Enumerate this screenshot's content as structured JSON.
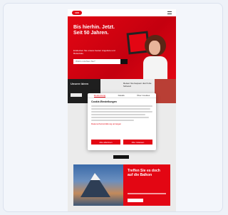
{
  "header": {
    "logo_text": "SBB"
  },
  "hero": {
    "title": "Bis hierhin. Jetzt. Seit 50 Jahren.",
    "subtitle": "Entdecken Sie unsere besten Angebote und Reiseziele.",
    "search_placeholder": "Wohin möchten Sie?"
  },
  "strip": {
    "left_title": "Unsere Ideen",
    "mid_text": "Reisen Sie bequem durch die Schweiz"
  },
  "cookie_modal": {
    "tabs": [
      "Zustimmung",
      "Details",
      "Über Cookies"
    ],
    "title": "Cookie-Einstellungen",
    "link_text": "Datenschutzerklärung anzeigen",
    "buttons": [
      "Alle ablehnen",
      "Alle zulassen"
    ]
  },
  "mountain": {
    "title": "Treffen Sie es doch auf die Balkon"
  },
  "colors": {
    "brand": "#e30613",
    "dark": "#111111"
  }
}
